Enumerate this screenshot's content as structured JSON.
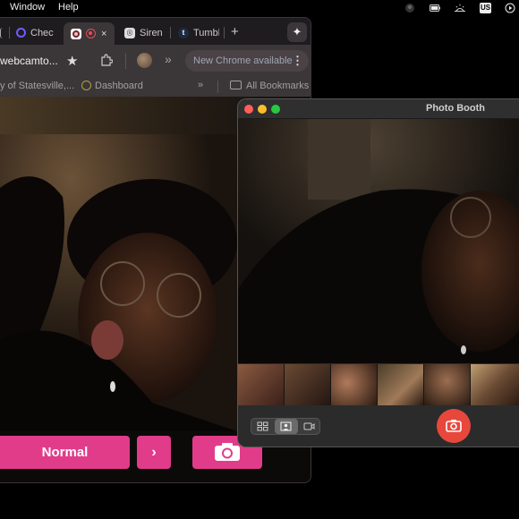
{
  "menubar": {
    "items": [
      "Window",
      "Help"
    ],
    "input_source": "US",
    "icons": [
      "circle-icon",
      "battery-icon",
      "brightness-icon",
      "input-source-icon",
      "play-icon"
    ]
  },
  "chrome": {
    "tabs": [
      {
        "label": "Chec",
        "icon": "checker-icon",
        "color": "#6d5cff"
      },
      {
        "label": "",
        "icon": "record-icon",
        "color": "#e84b5c",
        "active": true,
        "close": "×"
      },
      {
        "label": "Siren",
        "icon": "siren-icon",
        "color": "#8a8a8a"
      },
      {
        "label": "Tumbl",
        "icon": "tumblr-icon",
        "color": "#2a3a5a"
      }
    ],
    "new_tab": "+",
    "address": "webcamto...",
    "update_text": "New Chrome available",
    "bookmarks": {
      "item1": "y of Statesville,...",
      "item2": "Dashboard",
      "overflow": "»",
      "all": "All Bookmarks"
    }
  },
  "webcam_site": {
    "mode_button": "Normal",
    "next_button": "›"
  },
  "photo_booth": {
    "title": "Photo Booth",
    "thumbnails": 6,
    "modes": [
      "grid-mode",
      "single-photo-mode",
      "video-mode"
    ],
    "selected_mode": "single-photo-mode"
  },
  "colors": {
    "accent_pink": "#e13c8a",
    "shutter_red": "#e8473c",
    "traffic_close": "#ff5f57",
    "traffic_min": "#febc2e",
    "traffic_max": "#28c840"
  }
}
